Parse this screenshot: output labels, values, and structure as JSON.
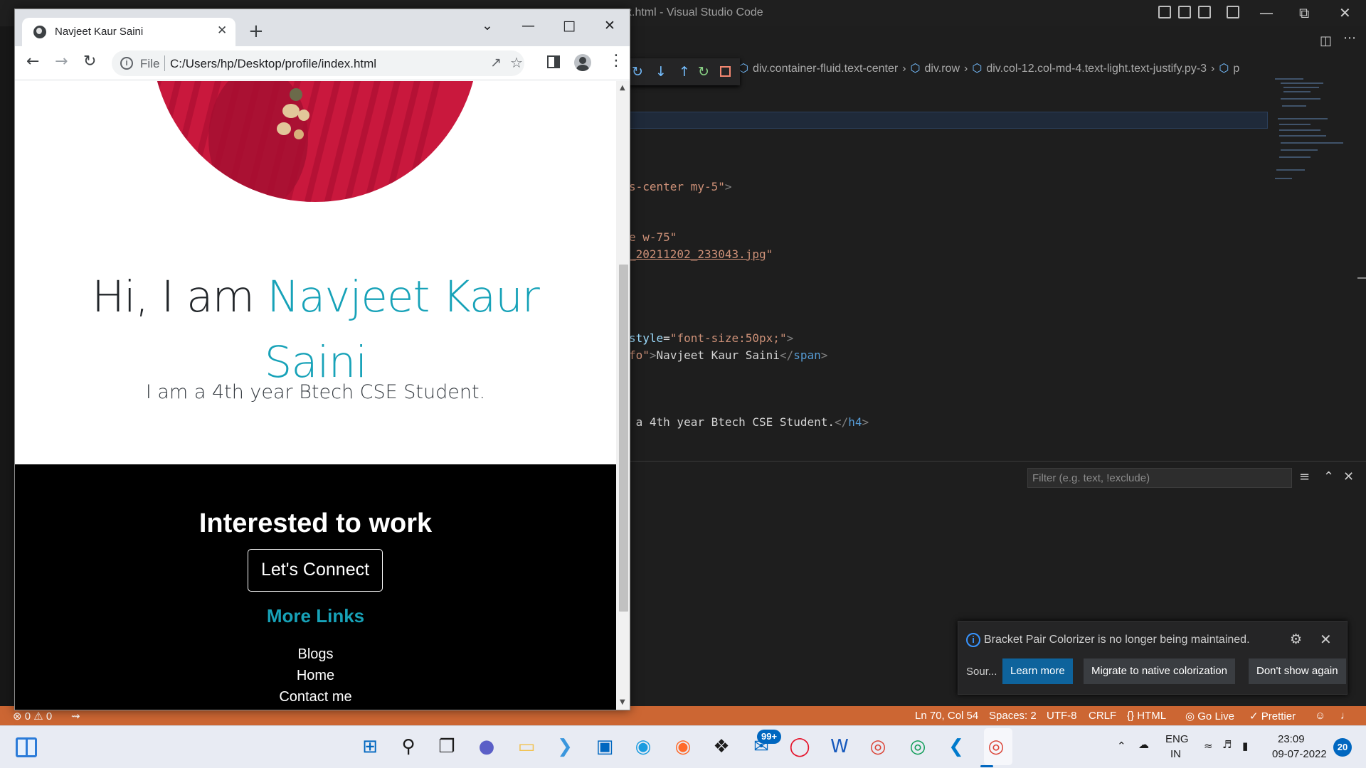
{
  "vscode": {
    "window_title": "x.html - Visual Studio Code",
    "breadcrumb": [
      "div.container-fluid.text-center",
      "div.row",
      "div.col-12.col-md-4.text-light.text-justify.py-3",
      "p"
    ],
    "code_lines": [
      {
        "pre": "",
        "parts": [
          {
            "t": "s-center my-5\"",
            "c": "c-str"
          },
          {
            "t": ">",
            "c": "c-gray"
          }
        ]
      },
      {
        "pre": "",
        "parts": [
          {
            "t": "e w-75\"",
            "c": "c-str"
          }
        ]
      },
      {
        "pre": "",
        "parts": [
          {
            "t": "_20211202_233043.jpg",
            "c": "c-link"
          },
          {
            "t": "\"",
            "c": "c-str"
          }
        ]
      },
      {
        "pre": "",
        "parts": [
          {
            "t": "style",
            "c": "c-attr"
          },
          {
            "t": "=",
            "c": ""
          },
          {
            "t": "\"font-size:50px;\"",
            "c": "c-str"
          },
          {
            "t": ">",
            "c": "c-gray"
          }
        ]
      },
      {
        "pre": "",
        "parts": [
          {
            "t": "fo\"",
            "c": "c-str"
          },
          {
            "t": ">",
            "c": "c-gray"
          },
          {
            "t": "Navjeet Kaur Saini",
            "c": ""
          },
          {
            "t": "</",
            "c": "c-gray"
          },
          {
            "t": "span",
            "c": "c-tag"
          },
          {
            "t": ">",
            "c": "c-gray"
          }
        ]
      },
      {
        "pre": "",
        "parts": [
          {
            "t": " a 4th year Btech CSE Student.",
            "c": ""
          },
          {
            "t": "</",
            "c": "c-gray"
          },
          {
            "t": "h4",
            "c": "c-tag"
          },
          {
            "t": ">",
            "c": "c-gray"
          }
        ]
      }
    ],
    "filter_placeholder": "Filter (e.g. text, !exclude)",
    "notification": {
      "message": "Bracket Pair Colorizer is no longer being maintained.",
      "source": "Sour...",
      "buttons": [
        "Learn more",
        "Migrate to native colorization",
        "Don't show again"
      ]
    },
    "statusbar": {
      "errors": "0",
      "warnings": "0",
      "position": "Ln 70, Col 54",
      "spaces": "Spaces: 2",
      "encoding": "UTF-8",
      "eol": "CRLF",
      "language": "HTML",
      "golive": "Go Live",
      "prettier": "Prettier"
    }
  },
  "chrome": {
    "tab_title": "Navjeet Kaur Saini",
    "url_scheme": "File",
    "url": "C:/Users/hp/Desktop/profile/index.html"
  },
  "page": {
    "greeting": "Hi, I am ",
    "name": "Navjeet Kaur Saini",
    "subtitle": "I am a 4th year Btech CSE Student.",
    "cta_title": "Interested to work",
    "cta_button": "Let's Connect",
    "more_links_title": "More Links",
    "links": [
      "Blogs",
      "Home",
      "Contact me"
    ]
  },
  "taskbar": {
    "mail_badge": "99+",
    "lang_line1": "ENG",
    "lang_line2": "IN",
    "time": "23:09",
    "date": "09-07-2022",
    "notification_count": "20",
    "apps": [
      "start-icon",
      "search-icon",
      "task-view-icon",
      "teams-chat-icon",
      "file-explorer-icon",
      "powershell-icon",
      "store-icon",
      "edge-icon",
      "firefox-icon",
      "dropbox-icon",
      "mail-icon",
      "opera-icon",
      "word-icon",
      "chrome-icon",
      "chrome-icon",
      "vscode-icon",
      "chrome-icon"
    ]
  },
  "colors": {
    "accent_teal": "#17a2b8",
    "statusbar_orange": "#cc6633",
    "vscode_button_blue": "#0e639c",
    "windows_blue": "#0067c0"
  }
}
